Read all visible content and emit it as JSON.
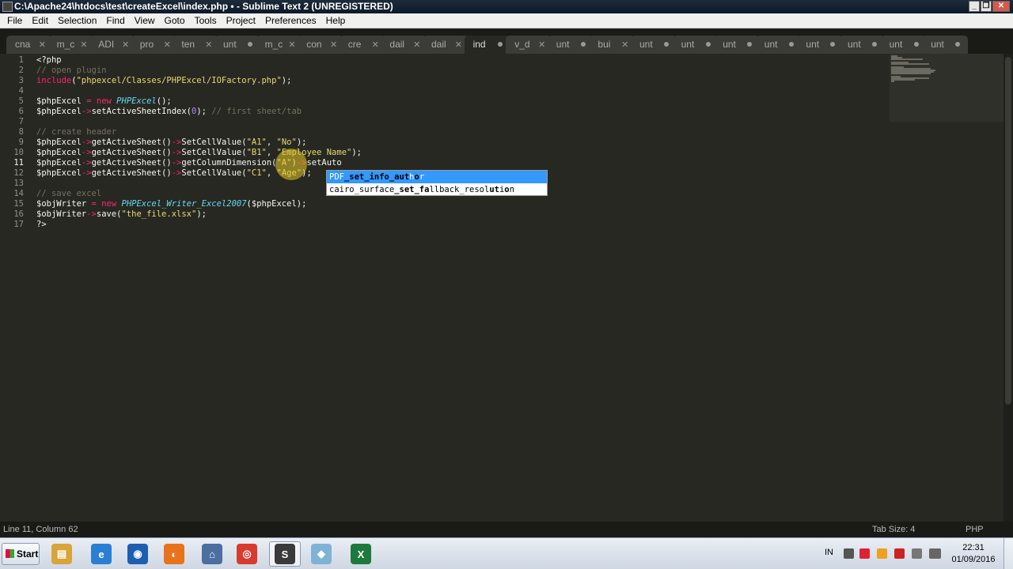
{
  "window": {
    "title": "C:\\Apache24\\htdocs\\test\\createExcel\\index.php • - Sublime Text 2 (UNREGISTERED)"
  },
  "window_buttons": {
    "minimize": "_",
    "maximize": "❐",
    "close": "✕"
  },
  "menu": [
    "File",
    "Edit",
    "Selection",
    "Find",
    "View",
    "Goto",
    "Tools",
    "Project",
    "Preferences",
    "Help"
  ],
  "tabs": [
    {
      "label": "cna",
      "state": "close"
    },
    {
      "label": "m_c",
      "state": "close"
    },
    {
      "label": "ADI",
      "state": "close"
    },
    {
      "label": "pro",
      "state": "close"
    },
    {
      "label": "ten",
      "state": "close"
    },
    {
      "label": "unt",
      "state": "dirty"
    },
    {
      "label": "m_c",
      "state": "close"
    },
    {
      "label": "con",
      "state": "close"
    },
    {
      "label": "cre",
      "state": "close"
    },
    {
      "label": "dail",
      "state": "close"
    },
    {
      "label": "dail",
      "state": "close"
    },
    {
      "label": "ind",
      "state": "dirty",
      "active": true
    },
    {
      "label": "v_d",
      "state": "close"
    },
    {
      "label": "unt",
      "state": "dirty"
    },
    {
      "label": "bui",
      "state": "close"
    },
    {
      "label": "unt",
      "state": "dirty"
    },
    {
      "label": "unt",
      "state": "dirty"
    },
    {
      "label": "unt",
      "state": "dirty"
    },
    {
      "label": "unt",
      "state": "dirty"
    },
    {
      "label": "unt",
      "state": "dirty"
    },
    {
      "label": "unt",
      "state": "dirty"
    },
    {
      "label": "unt",
      "state": "dirty"
    },
    {
      "label": "unt",
      "state": "dirty"
    }
  ],
  "tab_close_glyph": "✕",
  "editor": {
    "current_line": 11,
    "lines": [
      [
        {
          "t": "<?php",
          "c": "fn"
        }
      ],
      [
        {
          "t": "// open plugin",
          "c": "cmt"
        }
      ],
      [
        {
          "t": "include",
          "c": "kw"
        },
        {
          "t": "(",
          "c": "fn"
        },
        {
          "t": "\"phpexcel/Classes/PHPExcel/IOFactory.php\"",
          "c": "str"
        },
        {
          "t": ");",
          "c": "fn"
        }
      ],
      [],
      [
        {
          "t": "$phpExcel ",
          "c": "fn"
        },
        {
          "t": "=",
          "c": "kw"
        },
        {
          "t": " ",
          "c": "fn"
        },
        {
          "t": "new",
          "c": "kw"
        },
        {
          "t": " ",
          "c": "fn"
        },
        {
          "t": "PHPExcel",
          "c": "cls"
        },
        {
          "t": "();",
          "c": "fn"
        }
      ],
      [
        {
          "t": "$phpExcel",
          "c": "fn"
        },
        {
          "t": "->",
          "c": "kw"
        },
        {
          "t": "setActiveSheetIndex(",
          "c": "fn"
        },
        {
          "t": "0",
          "c": "num"
        },
        {
          "t": "); ",
          "c": "fn"
        },
        {
          "t": "// first sheet/tab",
          "c": "cmt"
        }
      ],
      [],
      [
        {
          "t": "// create header",
          "c": "cmt"
        }
      ],
      [
        {
          "t": "$phpExcel",
          "c": "fn"
        },
        {
          "t": "->",
          "c": "kw"
        },
        {
          "t": "getActiveSheet()",
          "c": "fn"
        },
        {
          "t": "->",
          "c": "kw"
        },
        {
          "t": "SetCellValue(",
          "c": "fn"
        },
        {
          "t": "\"A1\"",
          "c": "str"
        },
        {
          "t": ", ",
          "c": "fn"
        },
        {
          "t": "\"No\"",
          "c": "str"
        },
        {
          "t": ");",
          "c": "fn"
        }
      ],
      [
        {
          "t": "$phpExcel",
          "c": "fn"
        },
        {
          "t": "->",
          "c": "kw"
        },
        {
          "t": "getActiveSheet()",
          "c": "fn"
        },
        {
          "t": "->",
          "c": "kw"
        },
        {
          "t": "SetCellValue(",
          "c": "fn"
        },
        {
          "t": "\"B1\"",
          "c": "str"
        },
        {
          "t": ", ",
          "c": "fn"
        },
        {
          "t": "\"Employee Name\"",
          "c": "str"
        },
        {
          "t": ");",
          "c": "fn"
        }
      ],
      [
        {
          "t": "$phpExcel",
          "c": "fn"
        },
        {
          "t": "->",
          "c": "kw"
        },
        {
          "t": "getActiveSheet()",
          "c": "fn"
        },
        {
          "t": "->",
          "c": "kw"
        },
        {
          "t": "getColumnDimension(",
          "c": "fn"
        },
        {
          "t": "\"A\"",
          "c": "str"
        },
        {
          "t": ")",
          "c": "fn"
        },
        {
          "t": "->",
          "c": "kw"
        },
        {
          "t": "setAuto",
          "c": "fn"
        }
      ],
      [
        {
          "t": "$phpExcel",
          "c": "fn"
        },
        {
          "t": "->",
          "c": "kw"
        },
        {
          "t": "getActiveSheet()",
          "c": "fn"
        },
        {
          "t": "->",
          "c": "kw"
        },
        {
          "t": "SetCellValue(",
          "c": "fn"
        },
        {
          "t": "\"C1\"",
          "c": "str"
        },
        {
          "t": ", ",
          "c": "fn"
        },
        {
          "t": "\"Age\"",
          "c": "str"
        },
        {
          "t": ");",
          "c": "fn"
        }
      ],
      [],
      [
        {
          "t": "// save excel",
          "c": "cmt"
        }
      ],
      [
        {
          "t": "$objWriter ",
          "c": "fn"
        },
        {
          "t": "=",
          "c": "kw"
        },
        {
          "t": " ",
          "c": "fn"
        },
        {
          "t": "new",
          "c": "kw"
        },
        {
          "t": " ",
          "c": "fn"
        },
        {
          "t": "PHPExcel_Writer_Excel2007",
          "c": "cls"
        },
        {
          "t": "($phpExcel);",
          "c": "fn"
        }
      ],
      [
        {
          "t": "$objWriter",
          "c": "fn"
        },
        {
          "t": "->",
          "c": "kw"
        },
        {
          "t": "save(",
          "c": "fn"
        },
        {
          "t": "\"the_file.xlsx\"",
          "c": "str"
        },
        {
          "t": ");",
          "c": "fn"
        }
      ],
      [
        {
          "t": "?>",
          "c": "fn"
        }
      ]
    ]
  },
  "autocomplete": {
    "items": [
      {
        "parts": [
          {
            "t": "PDF",
            "m": false
          },
          {
            "t": "_set_info_aut",
            "m": true
          },
          {
            "t": "h",
            "m": false
          },
          {
            "t": "o",
            "m": true
          },
          {
            "t": "r",
            "m": false
          }
        ],
        "selected": true
      },
      {
        "parts": [
          {
            "t": "cairo_surface",
            "m": false
          },
          {
            "t": "_set_fa",
            "m": true
          },
          {
            "t": "llback_resol",
            "m": false
          },
          {
            "t": "ut",
            "m": true
          },
          {
            "t": "i",
            "m": false
          },
          {
            "t": "o",
            "m": true
          },
          {
            "t": "n",
            "m": false
          }
        ],
        "selected": false
      }
    ]
  },
  "status": {
    "position": "Line 11, Column 62",
    "tab_size": "Tab Size: 4",
    "syntax": "PHP"
  },
  "taskbar": {
    "start_label": "Start",
    "apps": [
      {
        "name": "explorer",
        "glyph": "▤",
        "color": "#d9a53a"
      },
      {
        "name": "internet-explorer",
        "glyph": "e",
        "color": "#2a7fd4"
      },
      {
        "name": "globe",
        "glyph": "◉",
        "color": "#1c5fb0"
      },
      {
        "name": "firefox",
        "glyph": "◐",
        "color": "#e8731c"
      },
      {
        "name": "network",
        "glyph": "⌂",
        "color": "#4a6fa0"
      },
      {
        "name": "chrome",
        "glyph": "◎",
        "color": "#d93a2e"
      },
      {
        "name": "sublime",
        "glyph": "S",
        "color": "#3a3a3a",
        "active": true
      },
      {
        "name": "eraser",
        "glyph": "◆",
        "color": "#7fb3d5"
      },
      {
        "name": "excel",
        "glyph": "X",
        "color": "#1e7a3c"
      }
    ],
    "tray_lang": "IN",
    "tray_icons": [
      {
        "name": "up-arrow",
        "color": "#555"
      },
      {
        "name": "red-tool",
        "color": "#d23"
      },
      {
        "name": "orange-circle",
        "color": "#f0a020"
      },
      {
        "name": "antivirus",
        "color": "#c22"
      },
      {
        "name": "monitor",
        "color": "#777"
      },
      {
        "name": "signal",
        "color": "#666"
      },
      {
        "name": "volume",
        "color": "#666"
      }
    ],
    "clock_time": "22:31",
    "clock_date": "01/09/2016"
  }
}
